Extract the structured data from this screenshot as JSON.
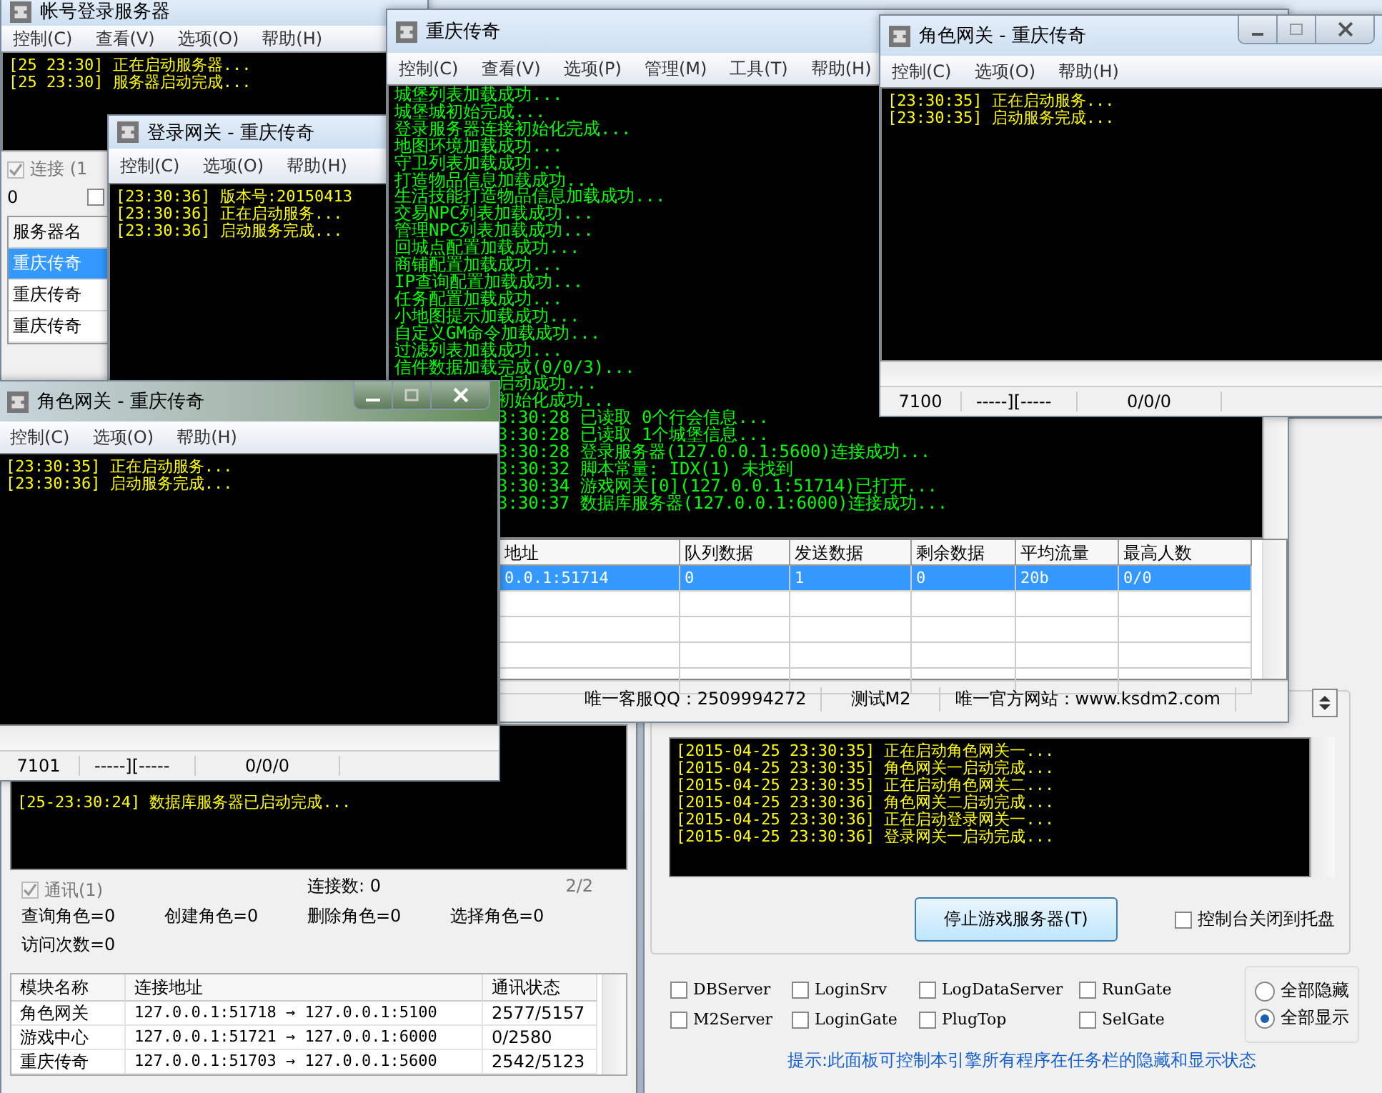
{
  "account_server": {
    "title": "帐号登录服务器",
    "menu": [
      "控制(C)",
      "查看(V)",
      "选项(O)",
      "帮助(H)"
    ],
    "log": [
      "[25 23:30] 正在启动服务器...",
      "[25 23:30] 服务器启动完成..."
    ],
    "connect_checkbox": {
      "label": "连接 (1",
      "checked": true
    },
    "count": "0",
    "extra_checkbox": {
      "checked": false
    },
    "server_list": {
      "header": "服务器名",
      "items": [
        {
          "name": "重庆传奇",
          "selected": true
        },
        {
          "name": "重庆传奇",
          "selected": false
        },
        {
          "name": "重庆传奇",
          "selected": false
        }
      ]
    }
  },
  "db_server": {
    "log": [
      "[25-23:30:24] 数据库服务器已启动完成..."
    ],
    "comm_checkbox": {
      "label": "通讯(1)",
      "checked": true
    },
    "connections": "连接数: 0",
    "page": "2/2",
    "stats": [
      "查询角色=0",
      "创建角色=0",
      "删除角色=0",
      "选择角色=0",
      "访问次数=0"
    ],
    "table": {
      "columns": [
        "模块名称",
        "连接地址",
        "通讯状态"
      ],
      "rows": [
        [
          "角色网关",
          "127.0.0.1:51718 → 127.0.0.1:5100",
          "2577/5157"
        ],
        [
          "游戏中心",
          "127.0.0.1:51721 → 127.0.0.1:6000",
          "0/2580"
        ],
        [
          "重庆传奇",
          "127.0.0.1:51703 → 127.0.0.1:5600",
          "2542/5123"
        ]
      ]
    }
  },
  "launcher": {
    "log": [
      "[2015-04-25 23:30:35] 正在启动角色网关一...",
      "[2015-04-25 23:30:35] 角色网关一启动完成...",
      "[2015-04-25 23:30:35] 正在启动角色网关二...",
      "[2015-04-25 23:30:36] 角色网关二启动完成...",
      "[2015-04-25 23:30:36] 正在启动登录网关一...",
      "[2015-04-25 23:30:36] 登录网关一启动完成..."
    ],
    "stop_button": "停止游戏服务器(T)",
    "tray_checkbox": {
      "label": "控制台关闭到托盘",
      "checked": false
    },
    "programs": [
      {
        "label": "DBServer",
        "checked": false
      },
      {
        "label": "LoginSrv",
        "checked": false
      },
      {
        "label": "LogDataServer",
        "checked": false
      },
      {
        "label": "RunGate",
        "checked": false
      },
      {
        "label": "M2Server",
        "checked": false
      },
      {
        "label": "LoginGate",
        "checked": false
      },
      {
        "label": "PlugTop",
        "checked": false
      },
      {
        "label": "SelGate",
        "checked": false
      }
    ],
    "radios": [
      {
        "label": "全部隐藏",
        "selected": false
      },
      {
        "label": "全部显示",
        "selected": true
      }
    ],
    "hint": "提示:此面板可控制本引擎所有程序在任务栏的隐藏和显示状态"
  },
  "login_gate": {
    "title": "登录网关 - 重庆传奇",
    "menu": [
      "控制(C)",
      "选项(O)",
      "帮助(H)"
    ],
    "log": [
      "[23:30:36] 版本号:20150413",
      "[23:30:36] 正在启动服务...",
      "[23:30:36] 启动服务完成..."
    ]
  },
  "m2_server": {
    "title": "重庆传奇",
    "menu": [
      "控制(C)",
      "查看(V)",
      "选项(P)",
      "管理(M)",
      "工具(T)",
      "帮助(H)"
    ],
    "log": [
      {
        "text": "城堡列表加载成功...",
        "kind": "full"
      },
      {
        "text": "城堡城初始完成...",
        "kind": "full"
      },
      {
        "text": "登录服务器连接初始化完成...",
        "kind": "full"
      },
      {
        "text": "地图环境加载成功...",
        "kind": "full"
      },
      {
        "text": "守卫列表加载成功...",
        "kind": "full"
      },
      {
        "text": "打造物品信息加载成功...",
        "kind": "full"
      },
      {
        "text": "生活技能打造物品信息加载成功...",
        "kind": "full"
      },
      {
        "text": "交易NPC列表加载成功...",
        "kind": "full"
      },
      {
        "text": "管理NPC列表加载成功...",
        "kind": "full"
      },
      {
        "text": "回城点配置加载成功...",
        "kind": "full"
      },
      {
        "text": "商铺配置加载成功...",
        "kind": "full"
      },
      {
        "text": "IP查询配置加载成功...",
        "kind": "full"
      },
      {
        "text": "任务配置加载成功...",
        "kind": "full"
      },
      {
        "text": "小地图提示加载成功...",
        "kind": "full"
      },
      {
        "text": "自定义GM命令加载成功...",
        "kind": "full"
      },
      {
        "text": "过滤列表加载成功...",
        "kind": "full"
      },
      {
        "text": "信件数据加载完成(0/0/3)...",
        "kind": "full"
      },
      {
        "text": "启动成功...",
        "kind": "cut"
      },
      {
        "text": "初始化成功...",
        "kind": "cut"
      },
      {
        "text": "3:30:28 已读取 0个行会信息...",
        "kind": "cut"
      },
      {
        "text": "3:30:28 已读取 1个城堡信息...",
        "kind": "cut"
      },
      {
        "text": "3:30:28 登录服务器(127.0.0.1:5600)连接成功...",
        "kind": "cut"
      },
      {
        "text": "3:30:32 脚本常量: IDX(1) 未找到",
        "kind": "cut"
      },
      {
        "text": "3:30:34 游戏网关[0](127.0.0.1:51714)已打开...",
        "kind": "cut"
      },
      {
        "text": "3:30:37 数据库服务器(127.0.0.1:6000)连接成功...",
        "kind": "cut"
      }
    ],
    "table": {
      "columns": [
        "地址",
        "队列数据",
        "发送数据",
        "剩余数据",
        "平均流量",
        "最高人数"
      ],
      "rows": [
        {
          "cells": [
            "0.0.1:51714",
            "0",
            "1",
            "0",
            "20b",
            "0/0"
          ],
          "selected": true
        }
      ]
    },
    "status_bar": [
      "唯一客服QQ：2509994272",
      "测试M2",
      "唯一官方网站：www.ksdm2.com"
    ]
  },
  "role_gate_right": {
    "title": "角色网关 - 重庆传奇",
    "menu": [
      "控制(C)",
      "选项(O)",
      "帮助(H)"
    ],
    "log": [
      "[23:30:35] 正在启动服务...",
      "[23:30:35] 启动服务完成..."
    ],
    "status_bar": [
      "7100",
      "-----][-----",
      "0/0/0"
    ]
  },
  "role_gate_left": {
    "title": "角色网关 - 重庆传奇",
    "menu": [
      "控制(C)",
      "选项(O)",
      "帮助(H)"
    ],
    "log": [
      "[23:30:35] 正在启动服务...",
      "[23:30:36] 启动服务完成..."
    ],
    "status_bar": [
      "7101",
      "-----][-----",
      "0/0/0"
    ]
  }
}
